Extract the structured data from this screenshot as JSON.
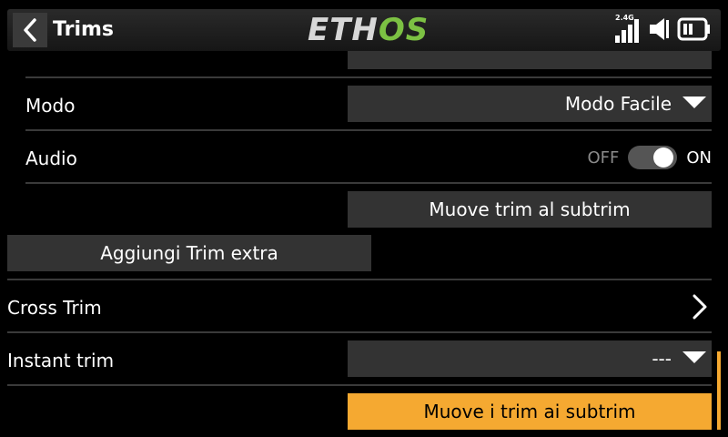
{
  "header": {
    "title": "Trims",
    "logo_main": "ETH",
    "logo_accent": "OS",
    "rf_band": "2.4G"
  },
  "rows": {
    "partial_label": "",
    "mode_label": "Modo",
    "mode_value": "Modo Facile",
    "audio_label": "Audio",
    "audio_off": "OFF",
    "audio_on": "ON",
    "audio_state": true,
    "move_trim_button": "Muove trim al subtrim",
    "add_trim_button": "Aggiungi Trim extra",
    "cross_trim_label": "Cross Trim",
    "instant_trim_label": "Instant trim",
    "instant_trim_value": "---",
    "move_all_trims_button": "Muove i trim ai subtrim"
  },
  "colors": {
    "accent": "#f5a931",
    "logo_green": "#7cc143",
    "field_bg": "#333333"
  }
}
